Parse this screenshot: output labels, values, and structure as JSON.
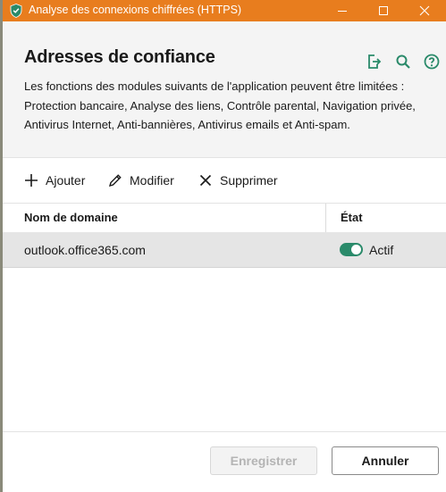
{
  "window": {
    "title": "Analyse des connexions chiffrées (HTTPS)"
  },
  "colors": {
    "titlebar": "#e87d1e",
    "accent": "#2a8a6a",
    "row_selected": "#e5e5e5"
  },
  "header": {
    "title": "Adresses de confiance",
    "description": "Les fonctions des modules suivants de l'application peuvent être limitées : Protection bancaire, Analyse des liens, Contrôle parental, Navigation privée, Antivirus Internet, Anti-bannières, Antivirus emails et Anti-spam.",
    "icons": [
      "export-icon",
      "search-icon",
      "help-icon"
    ]
  },
  "toolbar": {
    "add_label": "Ajouter",
    "edit_label": "Modifier",
    "delete_label": "Supprimer"
  },
  "table": {
    "columns": [
      "Nom de domaine",
      "État"
    ],
    "rows": [
      {
        "domain": "outlook.office365.com",
        "state": "Actif",
        "enabled": true
      }
    ]
  },
  "footer": {
    "save_label": "Enregistrer",
    "cancel_label": "Annuler"
  }
}
